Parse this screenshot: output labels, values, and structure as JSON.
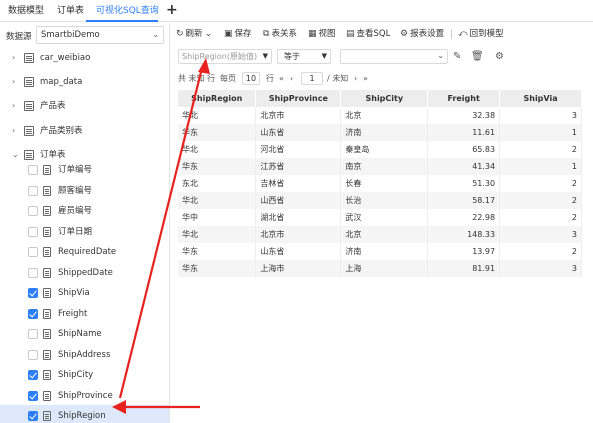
{
  "tabs": [
    {
      "label": "数据模型",
      "active": false
    },
    {
      "label": "订单表",
      "active": false
    },
    {
      "label": "可视化SQL查询",
      "active": true
    }
  ],
  "add_tab_icon": "plus-icon",
  "datasource": {
    "label": "数据源",
    "value": "SmartbiDemo"
  },
  "tree": {
    "tables": [
      {
        "label": "car_weibiao",
        "expanded": false
      },
      {
        "label": "map_data",
        "expanded": false
      },
      {
        "label": "产品表",
        "expanded": false
      },
      {
        "label": "产品类别表",
        "expanded": false
      },
      {
        "label": "订单表",
        "expanded": true
      }
    ],
    "fields": [
      {
        "label": "订单编号",
        "checked": false
      },
      {
        "label": "顾客编号",
        "checked": false
      },
      {
        "label": "雇员编号",
        "checked": false
      },
      {
        "label": "订单日期",
        "checked": false
      },
      {
        "label": "RequiredDate",
        "checked": false
      },
      {
        "label": "ShippedDate",
        "checked": false
      },
      {
        "label": "ShipVia",
        "checked": true
      },
      {
        "label": "Freight",
        "checked": true
      },
      {
        "label": "ShipName",
        "checked": false
      },
      {
        "label": "ShipAddress",
        "checked": false
      },
      {
        "label": "ShipCity",
        "checked": true
      },
      {
        "label": "ShipProvince",
        "checked": true
      },
      {
        "label": "ShipRegion",
        "checked": true,
        "selected": true
      }
    ]
  },
  "toolbar": {
    "refresh": "刷新",
    "save": "保存",
    "relations": "表关系",
    "view": "视图",
    "view_sql": "查看SQL",
    "report_settings": "报表设置",
    "back_to_model": "回到模型"
  },
  "filter": {
    "field_placeholder": "ShipRegion(原始值)",
    "operator": "等于",
    "value": ""
  },
  "pager": {
    "total_text": "共 未知 行",
    "per_page_label": "每页",
    "per_page": "10",
    "rows_label": "行",
    "page": "1",
    "page_total": "/ 未知"
  },
  "table": {
    "columns": [
      "ShipRegion",
      "ShipProvince",
      "ShipCity",
      "Freight",
      "ShipVia"
    ],
    "rows": [
      [
        "华北",
        "北京市",
        "北京",
        "32.38",
        "3"
      ],
      [
        "华东",
        "山东省",
        "济南",
        "11.61",
        "1"
      ],
      [
        "华北",
        "河北省",
        "秦皇岛",
        "65.83",
        "2"
      ],
      [
        "华东",
        "江苏省",
        "南京",
        "41.34",
        "1"
      ],
      [
        "东北",
        "吉林省",
        "长春",
        "51.30",
        "2"
      ],
      [
        "华北",
        "山西省",
        "长治",
        "58.17",
        "2"
      ],
      [
        "华中",
        "湖北省",
        "武汉",
        "22.98",
        "2"
      ],
      [
        "华北",
        "北京市",
        "北京",
        "148.33",
        "3"
      ],
      [
        "华东",
        "山东省",
        "济南",
        "13.97",
        "2"
      ],
      [
        "华东",
        "上海市",
        "上海",
        "81.91",
        "3"
      ]
    ]
  },
  "colors": {
    "accent": "#2d7ff9",
    "annotation": "#e8231f",
    "selected_row": "#dde9fb"
  }
}
